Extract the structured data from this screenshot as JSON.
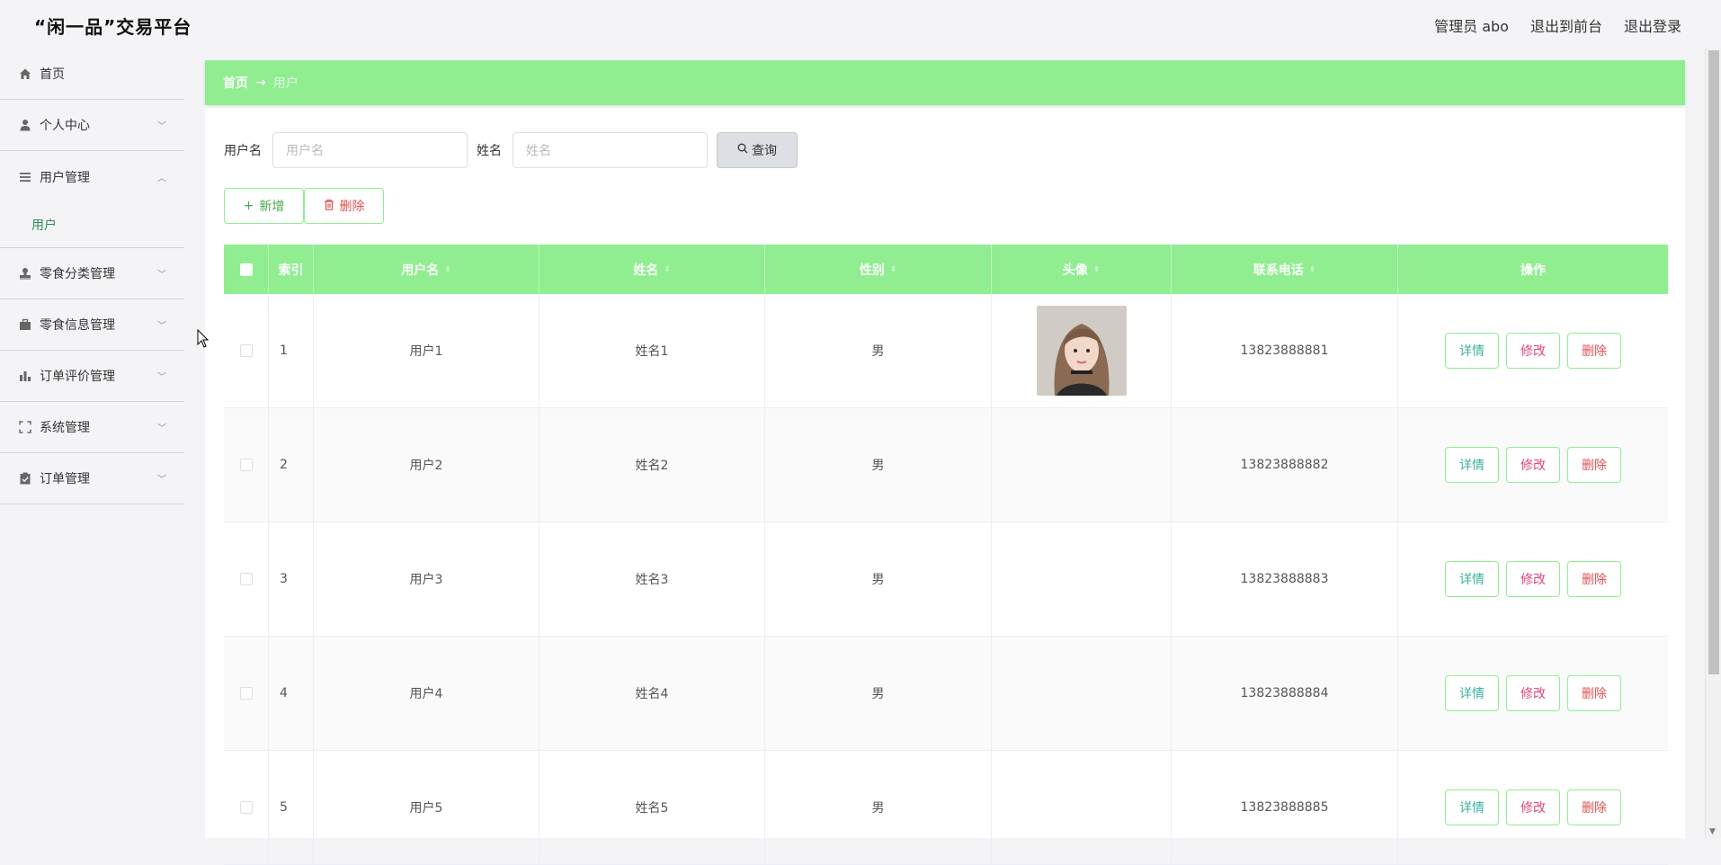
{
  "app": {
    "title": "“闲一品”交易平台"
  },
  "topnav": {
    "admin": "管理员 abo",
    "front": "退出到前台",
    "logout": "退出登录"
  },
  "sidebar": {
    "items": [
      {
        "label": "首页",
        "icon": "home-icon"
      },
      {
        "label": "个人中心",
        "icon": "user-icon"
      },
      {
        "label": "用户管理",
        "icon": "list-icon",
        "sub": "用户"
      },
      {
        "label": "零食分类管理",
        "icon": "stamp-icon"
      },
      {
        "label": "零食信息管理",
        "icon": "briefcase-icon"
      },
      {
        "label": "订单评价管理",
        "icon": "bar-chart-icon"
      },
      {
        "label": "系统管理",
        "icon": "fullscreen-icon"
      },
      {
        "label": "订单管理",
        "icon": "clipboard-check-icon"
      }
    ]
  },
  "breadcrumb": {
    "home": "首页",
    "arrow": "→",
    "current": "用户"
  },
  "search": {
    "username_label": "用户名",
    "username_placeholder": "用户名",
    "name_label": "姓名",
    "name_placeholder": "姓名",
    "query_label": "查询"
  },
  "actions": {
    "add_label": "新增",
    "delete_label": "删除"
  },
  "table": {
    "headers": [
      "索引",
      "用户名",
      "姓名",
      "性别",
      "头像",
      "联系电话",
      "操作"
    ],
    "rows": [
      {
        "index": "1",
        "username": "用户1",
        "name": "姓名1",
        "gender": "男",
        "phone": "13823888881",
        "has_avatar": true
      },
      {
        "index": "2",
        "username": "用户2",
        "name": "姓名2",
        "gender": "男",
        "phone": "13823888882",
        "has_avatar": false
      },
      {
        "index": "3",
        "username": "用户3",
        "name": "姓名3",
        "gender": "男",
        "phone": "13823888883",
        "has_avatar": false
      },
      {
        "index": "4",
        "username": "用户4",
        "name": "姓名4",
        "gender": "男",
        "phone": "13823888884",
        "has_avatar": false
      },
      {
        "index": "5",
        "username": "用户5",
        "name": "姓名5",
        "gender": "男",
        "phone": "13823888885",
        "has_avatar": false
      }
    ],
    "ops": {
      "detail": "详情",
      "edit": "修改",
      "delete": "删除"
    }
  },
  "colors": {
    "accent": "#90ee90",
    "sub_active": "#2e8b57"
  }
}
